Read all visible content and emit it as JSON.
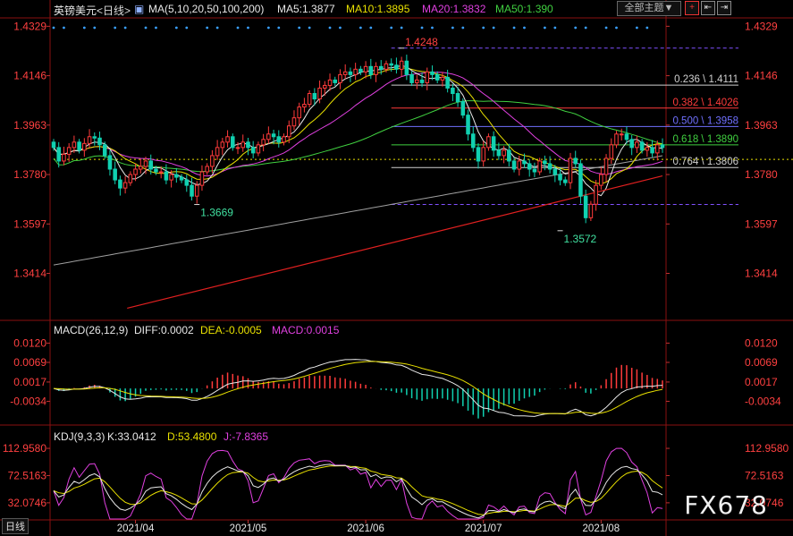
{
  "header": {
    "symbol": "英镑美元",
    "period": "<日线>",
    "ma_params": "MA(5,10,20,50,100,200)",
    "ma5": "MA5:1.3877",
    "ma10": "MA10:1.3895",
    "ma20": "MA20:1.3832",
    "ma50": "MA50:1.390",
    "theme_button": "全部主题▼",
    "btn_a": "+",
    "btn_b": "⇤",
    "btn_c": "⇥"
  },
  "colors": {
    "up": "#ff3b3b",
    "down": "#10d0b0",
    "ma5": "#e8e8e8",
    "ma10": "#e8e000",
    "ma20": "#e040e0",
    "ma50": "#40d040",
    "ma100": "#a0a0a0",
    "ma200": "#e02020"
  },
  "macd_panel": {
    "title": "MACD(26,12,9)",
    "diff": "DIFF:0.0002",
    "dea": "DEA:-0.0005",
    "macd": "MACD:0.0015"
  },
  "kdj_panel": {
    "title": "KDJ(9,3,3)",
    "k": "K:33.0412",
    "d": "D:53.4800",
    "j": "J:-7.8365"
  },
  "watermark": "FX678",
  "bottom_tab": "日线",
  "chart_data": [
    {
      "type": "candlestick",
      "name": "price",
      "ylim": [
        1.325,
        1.436
      ],
      "y_ticks": [
        "1.4329",
        "1.4146",
        "1.3963",
        "1.3780",
        "1.3597",
        "1.3414"
      ],
      "y_tick_values": [
        1.4329,
        1.4146,
        1.3963,
        1.378,
        1.3597,
        1.3414
      ],
      "x_ticks": [
        "2021/04",
        "2021/05",
        "2021/06",
        "2021/07",
        "2021/08"
      ],
      "x_tick_index": [
        16,
        38,
        61,
        84,
        107
      ],
      "annotations": [
        {
          "text": "1.4248",
          "index": 68,
          "value": 1.4248
        },
        {
          "text": "1.3669",
          "index": 28,
          "value": 1.3669
        },
        {
          "text": "1.3572",
          "index": 99,
          "value": 1.3572
        }
      ],
      "fib_levels": [
        {
          "label": "0.236 \\ 1.4111",
          "value": 1.4111,
          "color": "#cfcfcf"
        },
        {
          "label": "0.382 \\ 1.4026",
          "value": 1.4026,
          "color": "#ff3b3b"
        },
        {
          "label": "0.500 \\ 1.3958",
          "value": 1.3958,
          "color": "#7070ff"
        },
        {
          "label": "0.618 \\ 1.3890",
          "value": 1.389,
          "color": "#40d040"
        },
        {
          "label": "0.764 \\ 1.3806",
          "value": 1.3806,
          "color": "#cfcfcf"
        }
      ],
      "fib_bounds": [
        1.4248,
        1.3669
      ],
      "dashed_ref": 1.3836,
      "closes": [
        1.388,
        1.383,
        1.3855,
        1.388,
        1.39,
        1.387,
        1.3895,
        1.392,
        1.3915,
        1.389,
        1.385,
        1.38,
        1.376,
        1.373,
        1.375,
        1.378,
        1.38,
        1.381,
        1.383,
        1.38,
        1.379,
        1.379,
        1.376,
        1.378,
        1.377,
        1.376,
        1.374,
        1.37,
        1.374,
        1.379,
        1.381,
        1.385,
        1.388,
        1.39,
        1.392,
        1.388,
        1.388,
        1.39,
        1.388,
        1.386,
        1.389,
        1.391,
        1.393,
        1.392,
        1.39,
        1.392,
        1.396,
        1.399,
        1.403,
        1.404,
        1.408,
        1.406,
        1.41,
        1.411,
        1.413,
        1.412,
        1.415,
        1.416,
        1.415,
        1.417,
        1.416,
        1.418,
        1.415,
        1.418,
        1.417,
        1.419,
        1.4185,
        1.417,
        1.42,
        1.415,
        1.412,
        1.413,
        1.412,
        1.416,
        1.415,
        1.413,
        1.414,
        1.41,
        1.408,
        1.405,
        1.4,
        1.393,
        1.388,
        1.383,
        1.388,
        1.392,
        1.387,
        1.385,
        1.387,
        1.383,
        1.38,
        1.383,
        1.382,
        1.38,
        1.379,
        1.383,
        1.382,
        1.38,
        1.378,
        1.376,
        1.375,
        1.384,
        1.382,
        1.37,
        1.362,
        1.367,
        1.374,
        1.378,
        1.384,
        1.389,
        1.393,
        1.393,
        1.391,
        1.388,
        1.39,
        1.387,
        1.388,
        1.386,
        1.389,
        1.388
      ],
      "ma200": {
        "start_index": 10,
        "start": 1.3285,
        "end": 1.3775
      }
    },
    {
      "type": "bar",
      "name": "MACD(26,12,9)",
      "ylim": [
        -0.0085,
        0.014
      ],
      "y_ticks": [
        "0.0120",
        "0.0069",
        "0.0017",
        "-0.0034"
      ],
      "y_tick_values": [
        0.012,
        0.0069,
        0.0017,
        -0.0034
      ],
      "series": [
        {
          "name": "DIFF",
          "value": 0.0002
        },
        {
          "name": "DEA",
          "value": -0.0005
        },
        {
          "name": "MACD",
          "value": 0.0015
        }
      ]
    },
    {
      "type": "line",
      "name": "KDJ(9,3,3)",
      "ylim": [
        8,
        125
      ],
      "y_ticks": [
        "112.9580",
        "72.5163",
        "32.0746"
      ],
      "y_tick_values": [
        112.958,
        72.5163,
        32.0746
      ],
      "series": [
        {
          "name": "K",
          "value": 33.0412
        },
        {
          "name": "D",
          "value": 53.48
        },
        {
          "name": "J",
          "value": -7.8365
        }
      ]
    }
  ]
}
